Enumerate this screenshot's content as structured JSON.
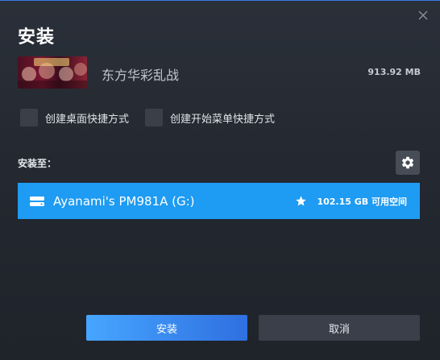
{
  "dialog": {
    "title": "安装"
  },
  "game": {
    "name": "东方华彩乱战",
    "size": "913.92 MB"
  },
  "options": [
    {
      "label": "创建桌面快捷方式",
      "checked": false
    },
    {
      "label": "创建开始菜单快捷方式",
      "checked": false
    }
  ],
  "install_location": {
    "label": "安装至：",
    "drive_name": "Ayanami's PM981A (G:)",
    "free_space": "102.15 GB 可用空间",
    "is_default": true
  },
  "buttons": {
    "install": "安装",
    "cancel": "取消"
  },
  "icons": {
    "close": "close-icon",
    "settings": "gear-icon",
    "drive": "drive-icon",
    "default": "star-icon"
  },
  "colors": {
    "accent": "#1e9bf2",
    "install_button_start": "#46a6ff",
    "install_button_end": "#2f6fe0",
    "background": "#23272f"
  }
}
